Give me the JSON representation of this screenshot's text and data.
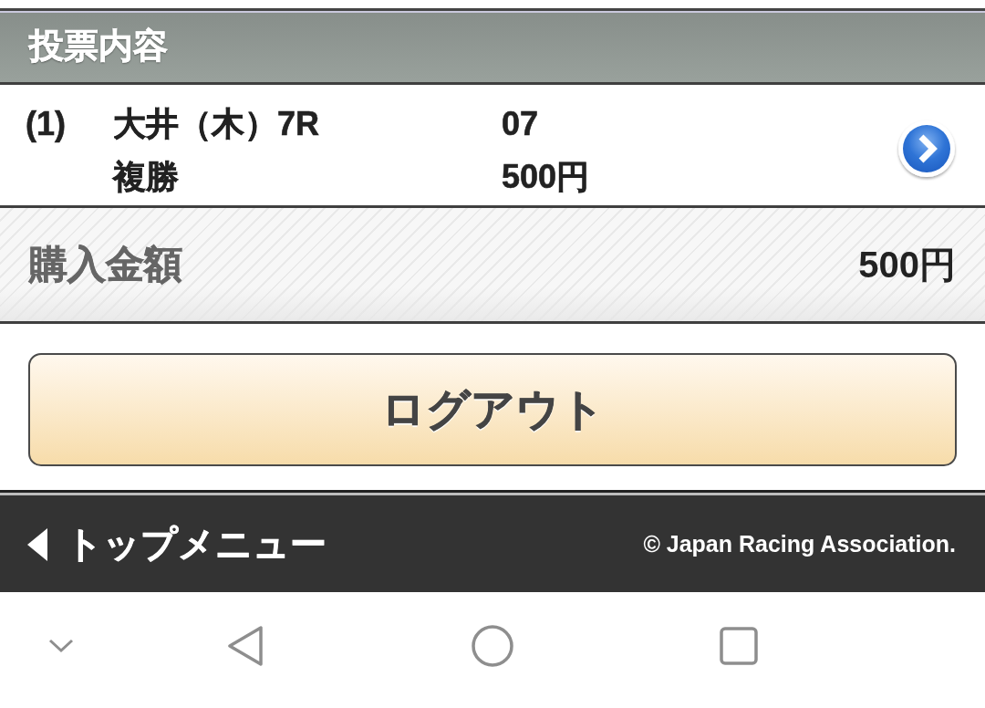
{
  "header": {
    "title": "投票内容"
  },
  "bets": [
    {
      "index": "(1)",
      "race": "大井（木）7R",
      "bet_type": "複勝",
      "selection": "07",
      "amount": "500円"
    }
  ],
  "total": {
    "label": "購入金額",
    "amount": "500円"
  },
  "logout_button": {
    "label": "ログアウト"
  },
  "footer": {
    "back_link": "トップメニュー",
    "copyright": "© Japan Racing Association."
  }
}
